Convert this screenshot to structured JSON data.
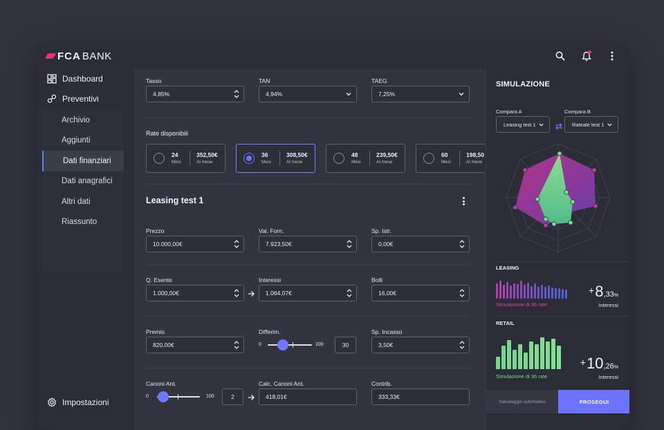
{
  "brand": {
    "logo_primary": "FCA",
    "logo_secondary": "BANK",
    "accent": "#e3316b"
  },
  "topbar": {
    "icons": [
      "search-icon",
      "bell-icon",
      "more-vertical-icon"
    ]
  },
  "sidebar": {
    "dashboard": "Dashboard",
    "preventivi": "Preventivi",
    "items": [
      {
        "label": "Archivio",
        "active": false
      },
      {
        "label": "Aggiunti",
        "active": false
      },
      {
        "label": "Dati finanziari",
        "active": true
      },
      {
        "label": "Dati anagrafici",
        "active": false
      },
      {
        "label": "Altri dati",
        "active": false
      },
      {
        "label": "Riassunto",
        "active": false
      }
    ],
    "impostazioni": "Impostazioni"
  },
  "rates": {
    "tasso_label": "Tasso",
    "tasso_value": "4,85%",
    "tan_label": "TAN",
    "tan_value": "4,94%",
    "taeg_label": "TAEG",
    "taeg_value": "7,25%"
  },
  "rate_disponibili": {
    "title": "Rate disponibili",
    "options": [
      {
        "months": "24",
        "months_label": "Mesi",
        "amount": "352,50€",
        "amount_label": "Al mese",
        "selected": false
      },
      {
        "months": "36",
        "months_label": "Mesi",
        "amount": "308,50€",
        "amount_label": "Al mese",
        "selected": true
      },
      {
        "months": "48",
        "months_label": "Mesi",
        "amount": "239,50€",
        "amount_label": "Al mese",
        "selected": false
      },
      {
        "months": "60",
        "months_label": "Mesi",
        "amount": "198,50",
        "amount_label": "Al mese",
        "selected": false
      }
    ]
  },
  "leasing": {
    "title": "Leasing test 1",
    "prezzo_label": "Prezzo",
    "prezzo_value": "10.000,00€",
    "valforn_label": "Val. Forn.",
    "valforn_value": "7.923,50€",
    "spistr_label": "Sp. Istr.",
    "spistr_value": "0,00€",
    "qesente_label": "Q. Esente",
    "qesente_value": "1.000,00€",
    "interessi_label": "Interessi",
    "interessi_value": "1.064,07€",
    "bolli_label": "Bolli",
    "bolli_value": "16,00€",
    "premio_label": "Premio",
    "premio_value": "820,00€",
    "differim_label": "Differim.",
    "differim_min": "0",
    "differim_max": "100",
    "differim_value": "30",
    "differim_fraction": 0.3,
    "spincasso_label": "Sp. Incasso",
    "spincasso_value": "3,50€",
    "canoni_label": "Canoni Ant.",
    "canoni_min": "0",
    "canoni_max": "100",
    "canoni_value": "2",
    "canoni_fraction": 0.02,
    "calc_label": "Calc. Canoni Ant.",
    "calc_value": "418,01€",
    "contrib_label": "Contrib.",
    "contrib_value": "333,33€"
  },
  "simulazione": {
    "title": "SIMULAZIONE",
    "compara_a_label": "Compara A",
    "compara_a_value": "Leasing test 1",
    "compara_b_label": "Compara B",
    "compara_b_value": "Rateale test 1",
    "leasing_label": "LEASING",
    "leasing_caption": "Simulazione di 36 rate",
    "leasing_pct_int": "8",
    "leasing_pct_dec": "33",
    "leasing_sign": "+",
    "retail_label": "RETAIL",
    "retail_caption": "Simulazione di 36 rate",
    "retail_pct_int": "10",
    "retail_pct_dec": "26",
    "retail_sign": "+",
    "interessi": "Interessi",
    "pct_symbol": "%",
    "colors": {
      "leasing": "#b23fa8",
      "retail": "#7fd88c",
      "accent": "#6b73ff"
    }
  },
  "footer": {
    "autosave": "Salvataggio automatico",
    "proceed": "PROSEGUI"
  }
}
